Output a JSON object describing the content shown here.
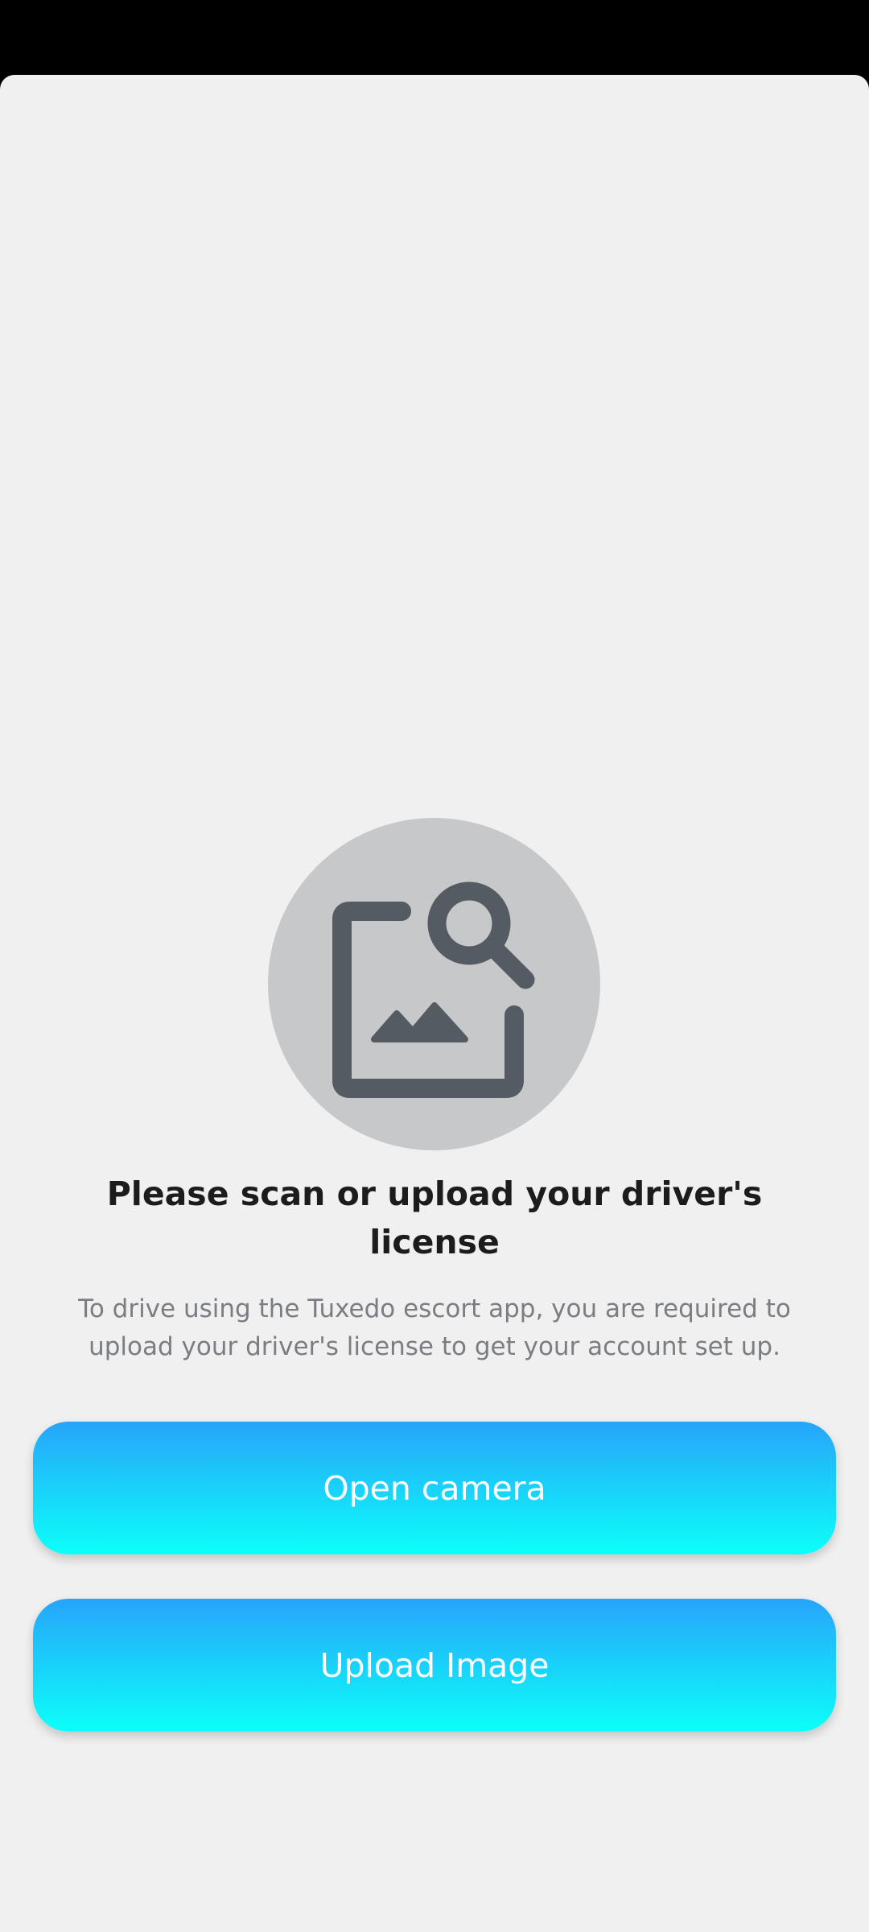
{
  "colors": {
    "background": "#f0f0f0",
    "illustration_circle": "#c7c8ca",
    "icon": "#555b62",
    "title": "#1c1c1c",
    "description": "#7a7d82",
    "button_gradient_top": "#27a4fb",
    "button_gradient_bottom": "#0cfff9",
    "button_text": "#ffffff"
  },
  "illustration": {
    "icon": "image-search-icon"
  },
  "content": {
    "title": "Please scan or upload your driver's license",
    "description": "To drive using the Tuxedo escort app, you are required to upload your driver's license to get your account set up."
  },
  "actions": {
    "open_camera_label": "Open camera",
    "upload_image_label": "Upload Image"
  }
}
